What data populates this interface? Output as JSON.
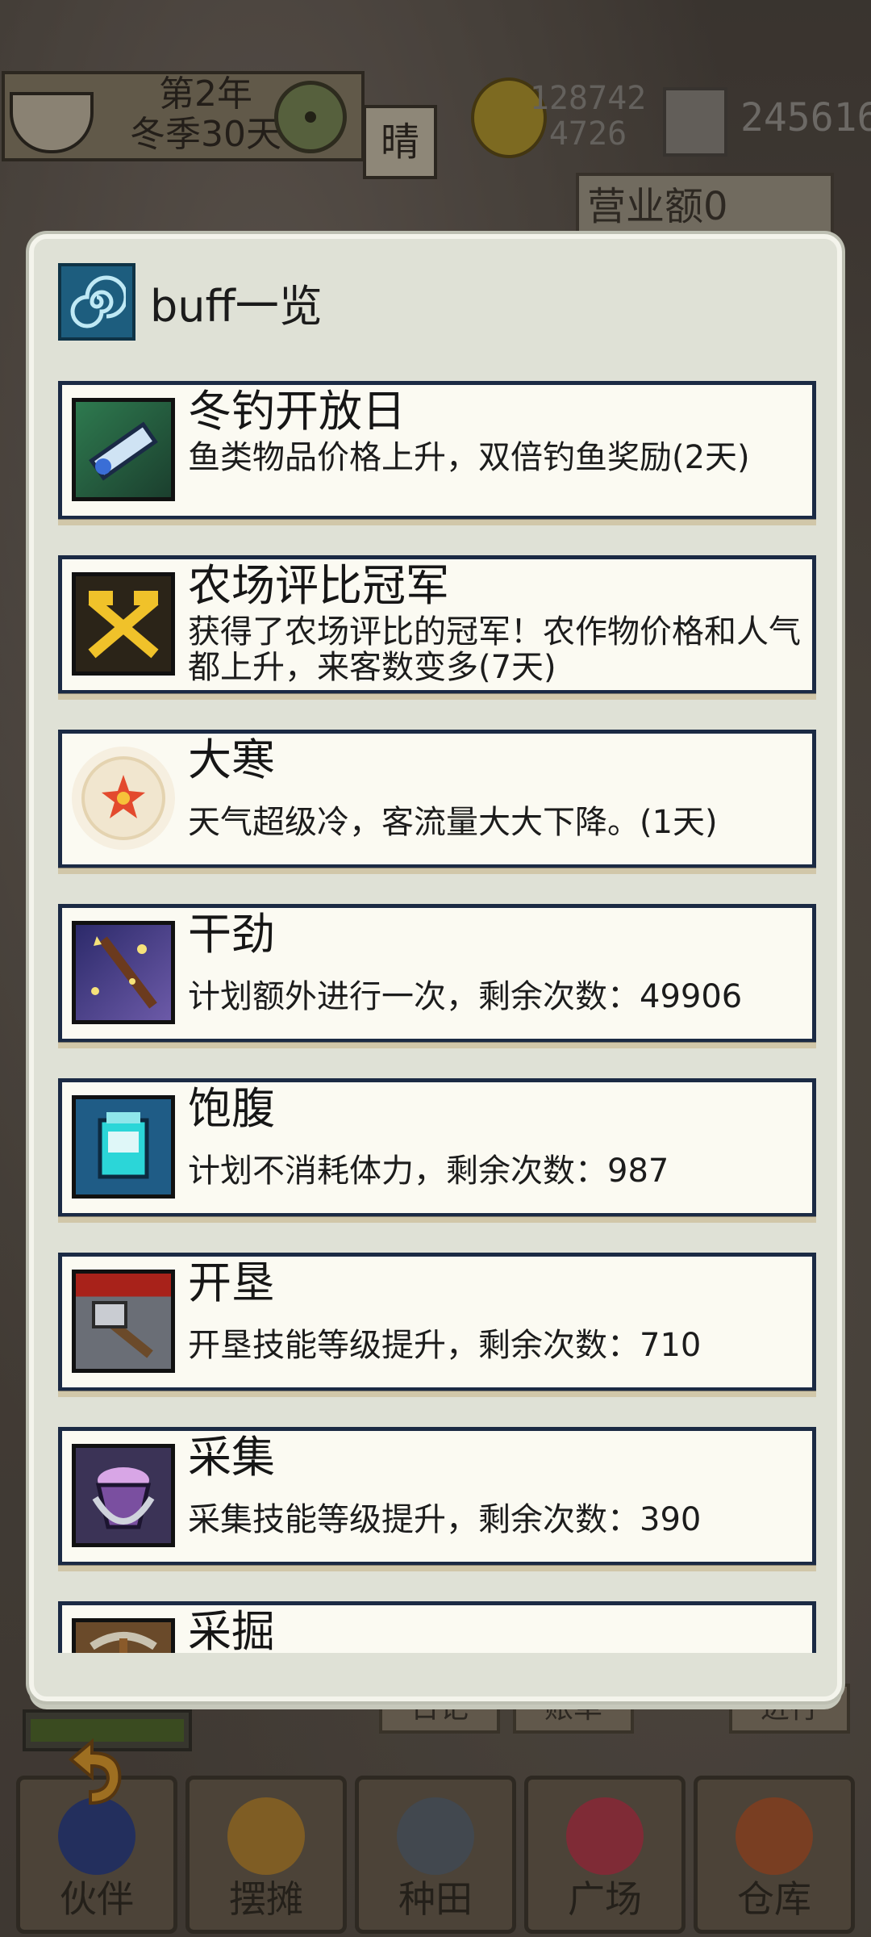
{
  "hud": {
    "year": "第2年",
    "season_day": "冬季30天",
    "weather": "晴",
    "money_line1": "128742",
    "money_line2": "4726",
    "gems": "245616",
    "revenue": "营业额0"
  },
  "modal": {
    "title": "buff一览",
    "icon": "swirl-icon"
  },
  "buffs": [
    {
      "name": "冬钓开放日",
      "desc": "鱼类物品价格上升，双倍钓鱼奖励(2天)",
      "icon": "fishing-rod-icon",
      "icon_color": "#2f6b4a"
    },
    {
      "name": "农场评比冠军",
      "desc": "获得了农场评比的冠军！农作物价格和人气都上升，来客数变多(7天)",
      "icon": "crossed-tools-icon",
      "icon_color": "#2b2418"
    },
    {
      "name": "大寒",
      "desc": "天气超级冷，客流量大大下降。(1天)",
      "icon": "snow-sun-icon",
      "icon_color": "#f1e6cf"
    },
    {
      "name": "干劲",
      "desc": "计划额外进行一次，剩余次数：49906",
      "icon": "magic-wand-icon",
      "icon_color": "#3b3170"
    },
    {
      "name": "饱腹",
      "desc": "计划不消耗体力，剩余次数：987",
      "icon": "potion-jar-icon",
      "icon_color": "#1f5c86"
    },
    {
      "name": "开垦",
      "desc": "开垦技能等级提升，剩余次数：710",
      "icon": "hoe-icon",
      "icon_color": "#5b5f66"
    },
    {
      "name": "采集",
      "desc": "采集技能等级提升，剩余次数：390",
      "icon": "basket-icon",
      "icon_color": "#4b3f66"
    },
    {
      "name": "采掘",
      "desc": "",
      "icon": "pickaxe-icon",
      "icon_color": "#6a4a2a"
    }
  ],
  "subbuttons": [
    "日记",
    "账单",
    "进行"
  ],
  "nav": [
    {
      "label": "伙伴",
      "icon": "partners-icon"
    },
    {
      "label": "摆摊",
      "icon": "stall-icon"
    },
    {
      "label": "种田",
      "icon": "watering-can-icon"
    },
    {
      "label": "广场",
      "icon": "flower-icon"
    },
    {
      "label": "仓库",
      "icon": "warehouse-icon"
    }
  ]
}
